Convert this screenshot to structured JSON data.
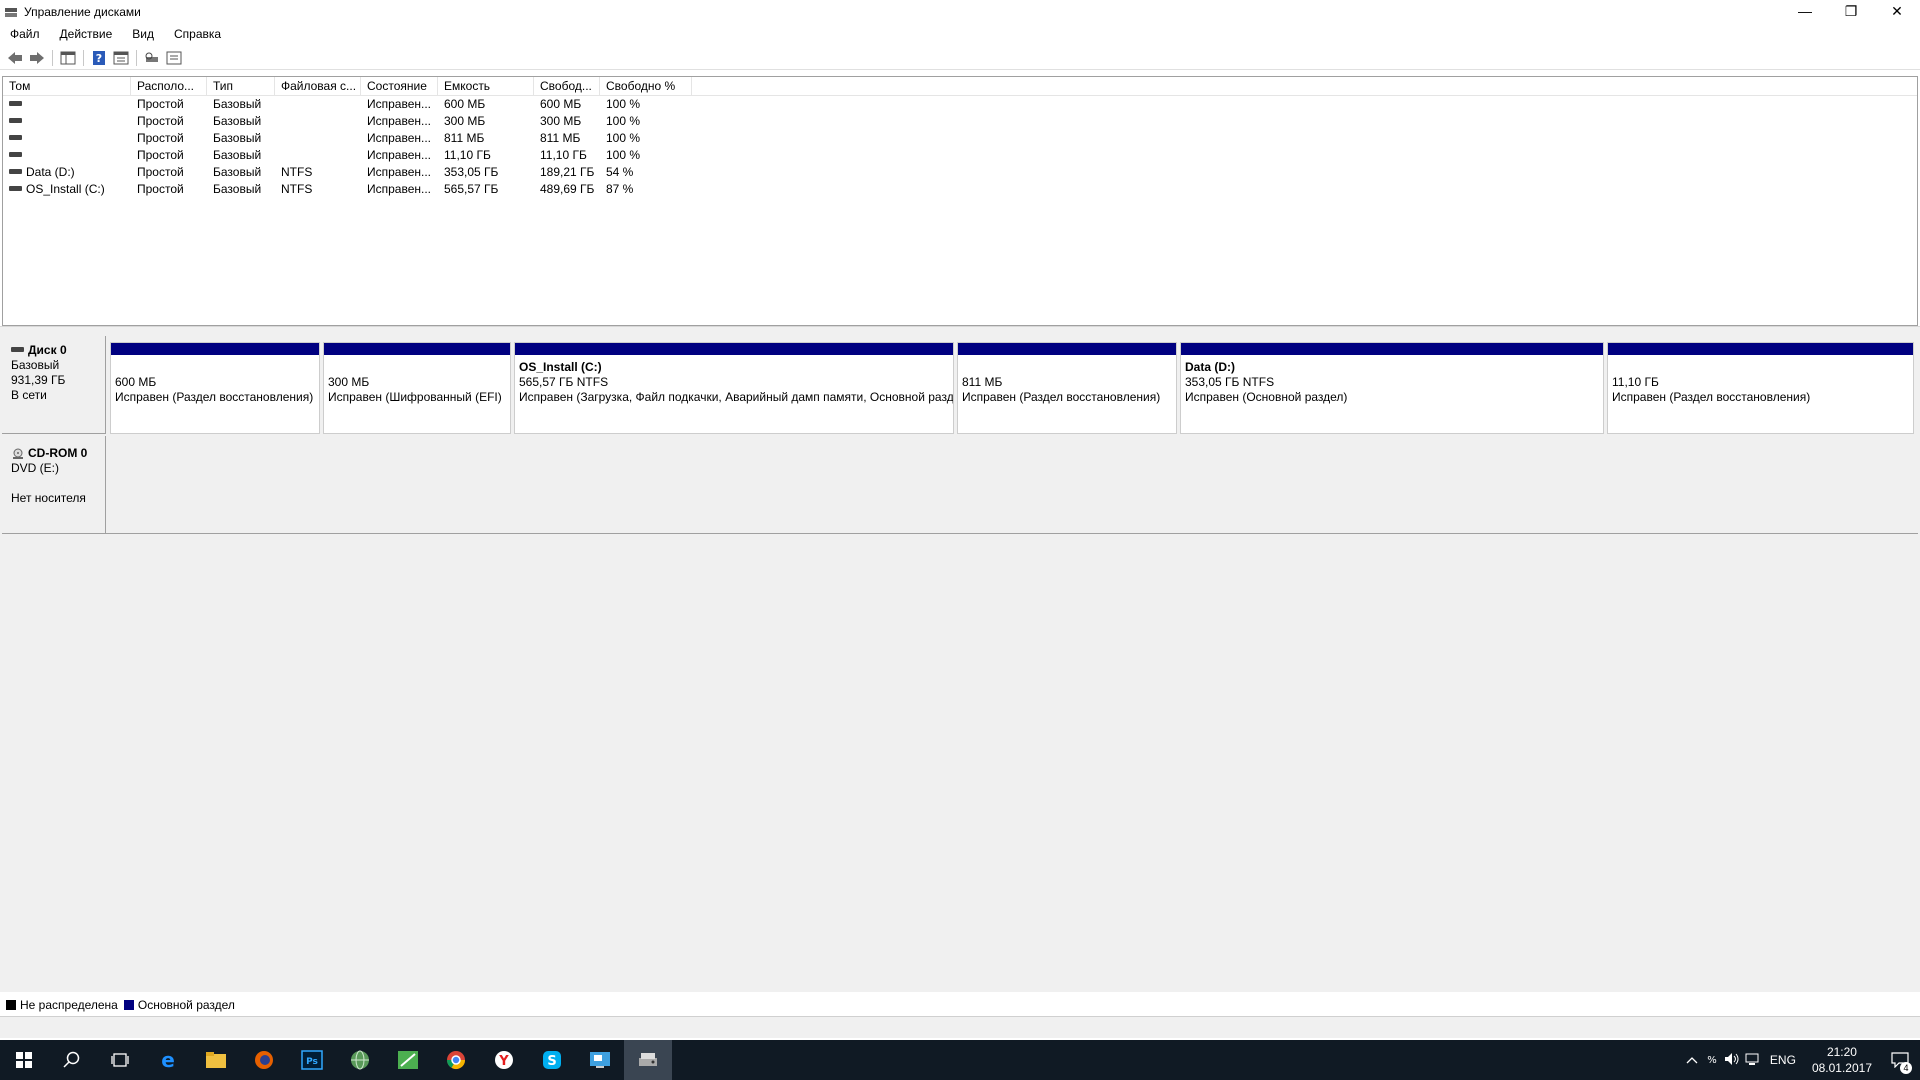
{
  "window": {
    "title": "Управление дисками",
    "controls": {
      "minimize": "—",
      "restore": "❐",
      "close": "✕"
    }
  },
  "menu": [
    "Файл",
    "Действие",
    "Вид",
    "Справка"
  ],
  "volume_list": {
    "columns": [
      "Том",
      "Располо...",
      "Тип",
      "Файловая с...",
      "Состояние",
      "Емкость",
      "Свобод...",
      "Свободно %"
    ],
    "rows": [
      [
        "",
        "Простой",
        "Базовый",
        "",
        "Исправен...",
        "600 МБ",
        "600 МБ",
        "100 %"
      ],
      [
        "",
        "Простой",
        "Базовый",
        "",
        "Исправен...",
        "300 МБ",
        "300 МБ",
        "100 %"
      ],
      [
        "",
        "Простой",
        "Базовый",
        "",
        "Исправен...",
        "811 МБ",
        "811 МБ",
        "100 %"
      ],
      [
        "",
        "Простой",
        "Базовый",
        "",
        "Исправен...",
        "11,10 ГБ",
        "11,10 ГБ",
        "100 %"
      ],
      [
        "Data (D:)",
        "Простой",
        "Базовый",
        "NTFS",
        "Исправен...",
        "353,05 ГБ",
        "189,21 ГБ",
        "54 %"
      ],
      [
        "OS_Install (C:)",
        "Простой",
        "Базовый",
        "NTFS",
        "Исправен...",
        "565,57 ГБ",
        "489,69 ГБ",
        "87 %"
      ]
    ]
  },
  "disks": {
    "disk0": {
      "name": "Диск 0",
      "type": "Базовый",
      "size": "931,39 ГБ",
      "status": "В сети",
      "partitions": [
        {
          "name": "",
          "size": "600 МБ",
          "status": "Исправен (Раздел восстановления)"
        },
        {
          "name": "",
          "size": "300 МБ",
          "status": "Исправен (Шифрованный (EFI)"
        },
        {
          "name": "OS_Install  (C:)",
          "size": "565,57 ГБ NTFS",
          "status": "Исправен (Загрузка, Файл подкачки, Аварийный дамп памяти, Основной раздел)"
        },
        {
          "name": "",
          "size": "811 МБ",
          "status": "Исправен (Раздел восстановления)"
        },
        {
          "name": "Data  (D:)",
          "size": "353,05 ГБ NTFS",
          "status": "Исправен (Основной раздел)"
        },
        {
          "name": "",
          "size": "11,10 ГБ",
          "status": "Исправен (Раздел восстановления)"
        }
      ]
    },
    "cdrom0": {
      "name": "CD-ROM 0",
      "drive": "DVD (E:)",
      "status": "Нет носителя"
    }
  },
  "legend": [
    {
      "label": "Не распределена",
      "color": "#000000"
    },
    {
      "label": "Основной раздел",
      "color": "#000080"
    }
  ],
  "taskbar": {
    "icons": [
      "windows-start-icon",
      "search-icon",
      "task-view-icon",
      "edge-icon",
      "file-explorer-icon",
      "firefox-icon",
      "photoshop-icon",
      "globe-app-icon",
      "spreadsheet-app-icon",
      "chrome-icon",
      "yandex-browser-icon",
      "skype-icon",
      "remote-desktop-icon",
      "disk-management-icon"
    ],
    "language": "ENG",
    "time": "21:20",
    "date": "08.01.2017",
    "notifications": "4"
  }
}
